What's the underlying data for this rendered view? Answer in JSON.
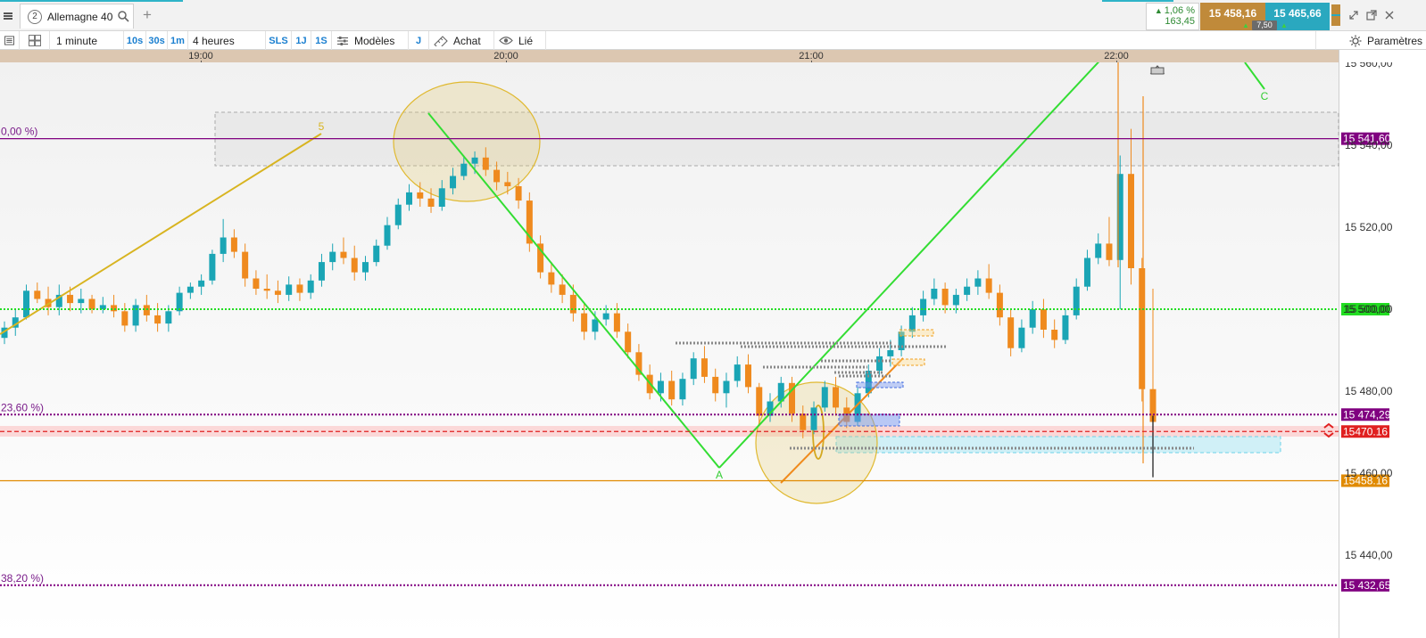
{
  "topbar": {
    "menu_icon": "hamburger-icon",
    "instrument_tab": {
      "number": "2",
      "name": "Allemagne 40",
      "icon": "search-icon"
    },
    "add_tab_label": "+",
    "quote": {
      "change_pct": "1,06 %",
      "change_pts": "163,45",
      "sell_price": "15 458,16",
      "buy_price": "15 465,66",
      "spread": "7,50"
    },
    "colors": {
      "sell": "#c08a3a",
      "buy": "#2aa8bf",
      "up": "#2d8a32"
    }
  },
  "toolbar": {
    "timeframe": "1 minute",
    "quick_intervals": [
      "10s",
      "30s",
      "1m"
    ],
    "range": "4 heures",
    "sls": "SLS",
    "one_day": "1J",
    "one_s": "1S",
    "models_label": "Modèles",
    "j_label": "J",
    "buy_label": "Achat",
    "linked_label": "Lié",
    "settings_label": "Paramètres"
  },
  "chart_data": {
    "type": "candlestick",
    "x_axis": {
      "tick_labels": [
        "19:00",
        "20:00",
        "21:00",
        "22:00"
      ],
      "range": [
        "18:30",
        "22:25"
      ]
    },
    "y_axis": {
      "tick_labels": [
        "15 560,00",
        "15 540,00",
        "15 520,00",
        "15 500,00",
        "15 480,00",
        "15 460,00",
        "15 440,00"
      ],
      "range": [
        15425.5,
        15560.5
      ]
    },
    "price_levels": [
      {
        "label": "15 541,60",
        "value": 15541.6,
        "color": "#800080",
        "style": "solid"
      },
      {
        "label": "15 500,00",
        "value": 15500.0,
        "color": "#22dd22",
        "style": "dotted"
      },
      {
        "label": "15 474,29",
        "value": 15474.29,
        "color": "#800080",
        "style": "dotted"
      },
      {
        "label": "15470.16",
        "value": 15470.16,
        "color": "#e02020",
        "style": "dashed"
      },
      {
        "label": "15458.16",
        "value": 15458.16,
        "color": "#e08a00",
        "style": "solid"
      },
      {
        "label": "15 432,65",
        "value": 15432.65,
        "color": "#800080",
        "style": "dotted"
      }
    ],
    "fib_labels": [
      {
        "text": "0,00 %)",
        "value": 15541.6
      },
      {
        "text": "23,60 %)",
        "value": 15474.29
      },
      {
        "text": "38,20 %)",
        "value": 15432.65
      }
    ],
    "wave_labels": [
      "5",
      "A",
      "C"
    ],
    "candle_colors": {
      "up": "#1aa5b5",
      "down": "#ef8a1e"
    },
    "candles": [
      [
        15493.0,
        15497.0,
        15491.5,
        15495.5
      ],
      [
        15495.5,
        15500.0,
        15493.5,
        15498.0
      ],
      [
        15498.0,
        15506.0,
        15497.5,
        15504.5
      ],
      [
        15504.5,
        15506.5,
        15501.5,
        15502.5
      ],
      [
        15502.5,
        15505.5,
        15498.5,
        15500.5
      ],
      [
        15500.5,
        15506.0,
        15498.5,
        15503.5
      ],
      [
        15503.5,
        15505.5,
        15499.5,
        15501.5
      ],
      [
        15501.5,
        15505.0,
        15499.0,
        15502.5
      ],
      [
        15502.5,
        15503.5,
        15499.0,
        15500.0
      ],
      [
        15500.0,
        15503.0,
        15499.0,
        15501.0
      ],
      [
        15501.0,
        15503.5,
        15498.0,
        15499.5
      ],
      [
        15499.5,
        15501.5,
        15494.5,
        15496.0
      ],
      [
        15496.0,
        15502.5,
        15494.5,
        15501.0
      ],
      [
        15501.0,
        15503.5,
        15497.0,
        15498.5
      ],
      [
        15498.5,
        15501.5,
        15494.5,
        15496.5
      ],
      [
        15496.5,
        15501.0,
        15494.5,
        15499.5
      ],
      [
        15499.5,
        15505.5,
        15498.5,
        15504.0
      ],
      [
        15504.0,
        15506.5,
        15502.5,
        15505.5
      ],
      [
        15505.5,
        15508.5,
        15503.5,
        15507.0
      ],
      [
        15507.0,
        15514.5,
        15506.0,
        15513.5
      ],
      [
        15513.5,
        15522.0,
        15511.5,
        15517.5
      ],
      [
        15517.5,
        15519.5,
        15512.5,
        15514.0
      ],
      [
        15514.0,
        15516.0,
        15505.5,
        15507.5
      ],
      [
        15507.5,
        15509.5,
        15503.5,
        15505.0
      ],
      [
        15505.0,
        15508.5,
        15502.5,
        15504.5
      ],
      [
        15504.5,
        15507.0,
        15501.5,
        15503.5
      ],
      [
        15503.5,
        15508.0,
        15502.0,
        15506.0
      ],
      [
        15506.0,
        15507.5,
        15502.0,
        15504.0
      ],
      [
        15504.0,
        15508.5,
        15502.5,
        15507.0
      ],
      [
        15507.0,
        15513.5,
        15505.5,
        15511.5
      ],
      [
        15511.5,
        15516.0,
        15509.5,
        15514.0
      ],
      [
        15514.0,
        15517.5,
        15511.0,
        15512.5
      ],
      [
        15512.5,
        15515.5,
        15507.0,
        15509.0
      ],
      [
        15509.0,
        15513.0,
        15507.0,
        15511.5
      ],
      [
        15511.5,
        15517.0,
        15510.5,
        15515.5
      ],
      [
        15515.5,
        15522.5,
        15514.5,
        15520.5
      ],
      [
        15520.5,
        15527.0,
        15519.5,
        15525.5
      ],
      [
        15525.5,
        15530.5,
        15524.0,
        15528.5
      ],
      [
        15528.5,
        15531.0,
        15525.0,
        15527.0
      ],
      [
        15527.0,
        15529.5,
        15523.5,
        15525.0
      ],
      [
        15525.0,
        15531.5,
        15524.0,
        15529.5
      ],
      [
        15529.5,
        15534.5,
        15528.0,
        15532.5
      ],
      [
        15532.5,
        15537.5,
        15531.5,
        15535.5
      ],
      [
        15535.5,
        15538.5,
        15533.0,
        15537.0
      ],
      [
        15537.0,
        15539.5,
        15532.5,
        15534.0
      ],
      [
        15534.0,
        15536.0,
        15529.0,
        15531.0
      ],
      [
        15531.0,
        15533.5,
        15528.0,
        15530.0
      ],
      [
        15530.0,
        15532.0,
        15524.5,
        15526.5
      ],
      [
        15526.5,
        15528.5,
        15514.0,
        15516.0
      ],
      [
        15516.0,
        15518.0,
        15507.5,
        15509.0
      ],
      [
        15509.0,
        15511.5,
        15504.0,
        15506.0
      ],
      [
        15506.0,
        15508.5,
        15501.5,
        15503.5
      ],
      [
        15503.5,
        15506.0,
        15497.0,
        15499.0
      ],
      [
        15499.0,
        15501.5,
        15492.5,
        15494.5
      ],
      [
        15494.5,
        15499.5,
        15492.5,
        15497.5
      ],
      [
        15497.5,
        15501.0,
        15496.0,
        15499.0
      ],
      [
        15499.0,
        15501.5,
        15493.0,
        15494.5
      ],
      [
        15494.5,
        15496.5,
        15488.0,
        15489.5
      ],
      [
        15489.5,
        15491.5,
        15482.5,
        15484.0
      ],
      [
        15484.0,
        15486.5,
        15478.0,
        15479.5
      ],
      [
        15479.5,
        15484.5,
        15477.5,
        15482.5
      ],
      [
        15482.5,
        15485.0,
        15476.5,
        15478.0
      ],
      [
        15478.0,
        15484.5,
        15476.5,
        15483.0
      ],
      [
        15483.0,
        15489.5,
        15481.5,
        15488.0
      ],
      [
        15488.0,
        15491.0,
        15482.0,
        15483.5
      ],
      [
        15483.5,
        15485.5,
        15477.5,
        15479.5
      ],
      [
        15479.5,
        15484.5,
        15476.0,
        15482.5
      ],
      [
        15482.5,
        15488.5,
        15481.0,
        15486.5
      ],
      [
        15486.5,
        15489.0,
        15479.5,
        15481.0
      ],
      [
        15481.0,
        15482.0,
        15472.0,
        15474.0
      ],
      [
        15474.0,
        15479.5,
        15472.5,
        15477.5
      ],
      [
        15477.5,
        15483.5,
        15476.0,
        15482.0
      ],
      [
        15482.0,
        15483.5,
        15472.5,
        15474.5
      ],
      [
        15474.5,
        15476.5,
        15468.5,
        15470.5
      ],
      [
        15470.5,
        15477.5,
        15469.5,
        15476.0
      ],
      [
        15476.0,
        15482.5,
        15475.0,
        15481.0
      ],
      [
        15481.0,
        15483.5,
        15474.0,
        15476.0
      ],
      [
        15476.0,
        15478.5,
        15471.0,
        15472.5
      ],
      [
        15472.5,
        15481.0,
        15471.5,
        15479.5
      ],
      [
        15479.5,
        15486.5,
        15478.5,
        15485.0
      ],
      [
        15485.0,
        15490.5,
        15483.5,
        15488.5
      ],
      [
        15488.5,
        15492.5,
        15486.0,
        15490.0
      ],
      [
        15490.0,
        15496.0,
        15488.5,
        15494.5
      ],
      [
        15494.5,
        15500.5,
        15493.0,
        15498.5
      ],
      [
        15498.5,
        15504.5,
        15497.0,
        15502.5
      ],
      [
        15502.5,
        15507.5,
        15501.0,
        15505.0
      ],
      [
        15505.0,
        15506.5,
        15499.0,
        15501.0
      ],
      [
        15501.0,
        15505.0,
        15499.0,
        15503.5
      ],
      [
        15503.5,
        15507.5,
        15502.0,
        15505.5
      ],
      [
        15505.5,
        15509.5,
        15503.5,
        15507.5
      ],
      [
        15507.5,
        15511.0,
        15502.5,
        15504.0
      ],
      [
        15504.0,
        15506.0,
        15496.0,
        15498.0
      ],
      [
        15498.0,
        15500.0,
        15488.5,
        15490.5
      ],
      [
        15490.5,
        15497.5,
        15489.5,
        15495.5
      ],
      [
        15495.5,
        15502.0,
        15494.0,
        15500.0
      ],
      [
        15500.0,
        15502.5,
        15493.0,
        15495.0
      ],
      [
        15495.0,
        15497.5,
        15490.5,
        15492.5
      ],
      [
        15492.5,
        15500.0,
        15491.5,
        15498.5
      ],
      [
        15498.5,
        15507.5,
        15497.5,
        15505.5
      ],
      [
        15505.5,
        15514.5,
        15504.5,
        15512.5
      ],
      [
        15512.5,
        15518.5,
        15511.0,
        15516.0
      ],
      [
        15516.0,
        15522.5,
        15510.5,
        15512.0
      ],
      [
        15512.0,
        15537.5,
        15500.0,
        15533.0
      ],
      [
        15533.0,
        15544.0,
        15506.0,
        15510.0
      ],
      [
        15510.0,
        15512.5,
        15477.5,
        15480.5
      ],
      [
        15480.5,
        15505.0,
        15460.5,
        15472.5
      ]
    ]
  }
}
